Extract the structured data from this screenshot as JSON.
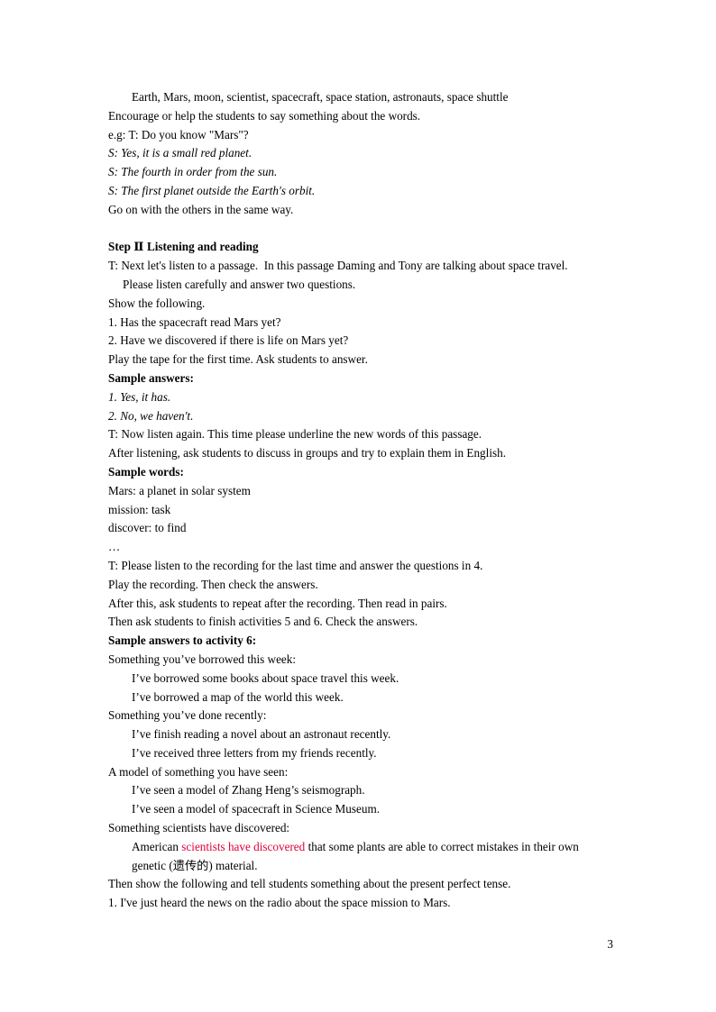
{
  "document": {
    "page_number": "3",
    "accent_red": "#e0003c",
    "background": "#ffffff",
    "text_color": "#000000"
  },
  "content": {
    "vocab_line": "Earth, Mars, moon, scientist, spacecraft, space station, astronauts, space shuttle",
    "encourage_line": "Encourage or help the students to say something about the words.",
    "eg_line": "e.g: T: Do you know \"Mars\"?",
    "student_line_1": "S: Yes, it is a small red planet.",
    "student_line_2": "S: The fourth in order from the sun.",
    "student_line_3": "S: The first planet outside the Earth's orbit.",
    "go_on_line": "Go on with the others in the same way.",
    "step2_heading_prefix": "Step ",
    "step2_heading_numeral": "Ⅱ",
    "step2_heading_rest": " Listening and reading",
    "teacher_intro_1": "T: Next let's listen to a passage.  In this passage Daming and Tony are talking about space travel.",
    "teacher_intro_2": "Please listen carefully and answer two questions.",
    "show_following": "Show the following.",
    "question_1": "1. Has the spacecraft read Mars yet?",
    "question_2": "2. Have we discovered if there is life on Mars yet?",
    "play_tape_line": "Play the tape for the first time. Ask students to answer.",
    "sample_answers_heading": "Sample answers:",
    "sample_answer_1": "1. Yes, it has.",
    "sample_answer_2": "2. No, we haven't.",
    "listen_again_line": "T: Now listen again. This time please underline the new words of this passage.",
    "after_listening_line": "After listening, ask students to discuss in groups and try to explain them in English.",
    "sample_words_heading": "Sample words:",
    "word_mars": "Mars: a planet in solar system",
    "word_mission": "mission: task",
    "word_discover": "discover: to find",
    "ellipsis": "…",
    "listen_last_time_line": "T: Please listen to the recording for the last time and answer the questions in 4.",
    "play_recording_line": "Play the recording. Then check the answers.",
    "repeat_after_line": "After this, ask students to repeat after the recording. Then read in pairs.",
    "activities_line": "Then ask students to finish activities 5 and 6. Check the answers.",
    "sample_answers_activity6_heading": "Sample answers to activity 6:",
    "prompt_borrowed": "Something you’ve borrowed this week:",
    "answer_borrowed_1": "I’ve borrowed some books about space travel this week.",
    "answer_borrowed_2": "I’ve borrowed a map of the world this week.",
    "prompt_done": "Something you’ve done recently:",
    "answer_done_1": "I’ve finish reading a novel about an astronaut recently.",
    "answer_done_2": "I’ve received three letters from my friends recently.",
    "prompt_model": "A model of something you have seen:",
    "answer_model_1": "I’ve seen a model of Zhang Heng’s seismograph.",
    "answer_model_2": "I’ve seen a model of spacecraft in Science Museum.",
    "prompt_discovered": "Something scientists have discovered:",
    "answer_discovered_pre": "American ",
    "answer_discovered_red": "scientists have discovered",
    "answer_discovered_post": " that some plants are able to correct mistakes in their own",
    "answer_discovered_line2": "genetic (遗传的) material.",
    "then_show_line": "Then show the following and tell students something about the present perfect tense.",
    "example_sentence_1": "1. I've just heard the news on the radio about the space mission to Mars."
  }
}
